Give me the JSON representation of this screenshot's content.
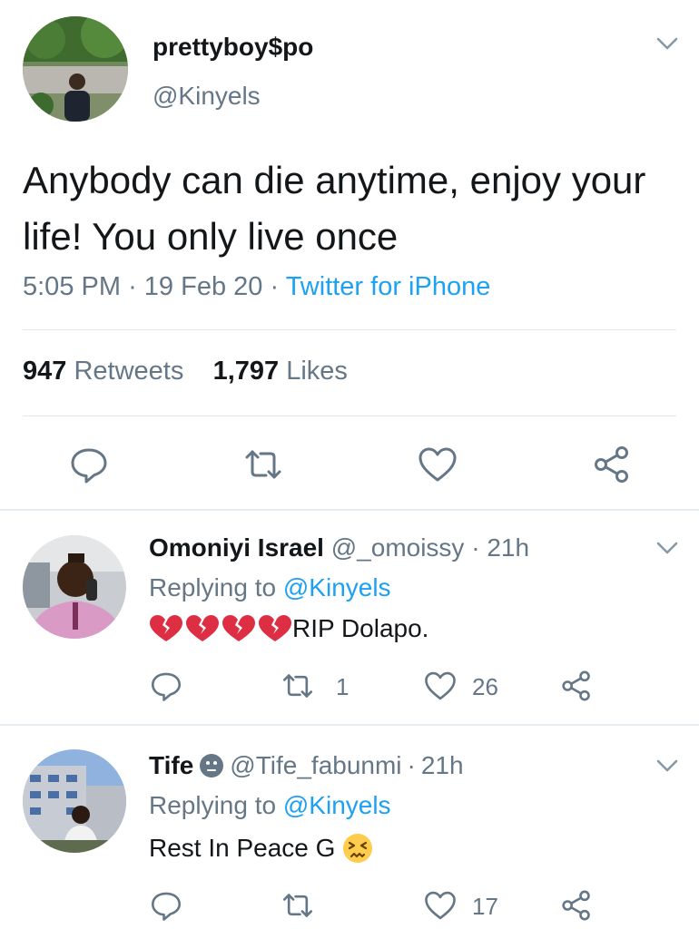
{
  "main_tweet": {
    "name": "prettyboy$po",
    "handle": "@Kinyels",
    "text": "Anybody can die anytime, enjoy your life! You only live once",
    "time": "5:05 PM",
    "date": "19 Feb 20",
    "source": "Twitter for iPhone",
    "retweets_count": "947",
    "retweets_label": "Retweets",
    "likes_count": "1,797",
    "likes_label": "Likes"
  },
  "replies": [
    {
      "name": "Omoniyi Israel",
      "handle": "@_omoissy",
      "time": "21h",
      "replying_prefix": "Replying to",
      "replying_mention": "@Kinyels",
      "text": "RIP Dolapo.",
      "retweets": "1",
      "likes": "26"
    },
    {
      "name": "Tife",
      "handle": "@Tife_fabunmi",
      "time": "21h",
      "replying_prefix": "Replying to",
      "replying_mention": "@Kinyels",
      "text": "Rest In Peace G",
      "retweets": "",
      "likes": "17"
    }
  ],
  "colors": {
    "accent": "#1da1f2",
    "secondary_text": "#657786",
    "icon": "#657786"
  },
  "icons": [
    "reply-icon",
    "retweet-icon",
    "like-icon",
    "share-icon",
    "chevron-down-icon",
    "broken-heart-emoji",
    "persevering-face-emoji",
    "neutral-face-emoji"
  ]
}
